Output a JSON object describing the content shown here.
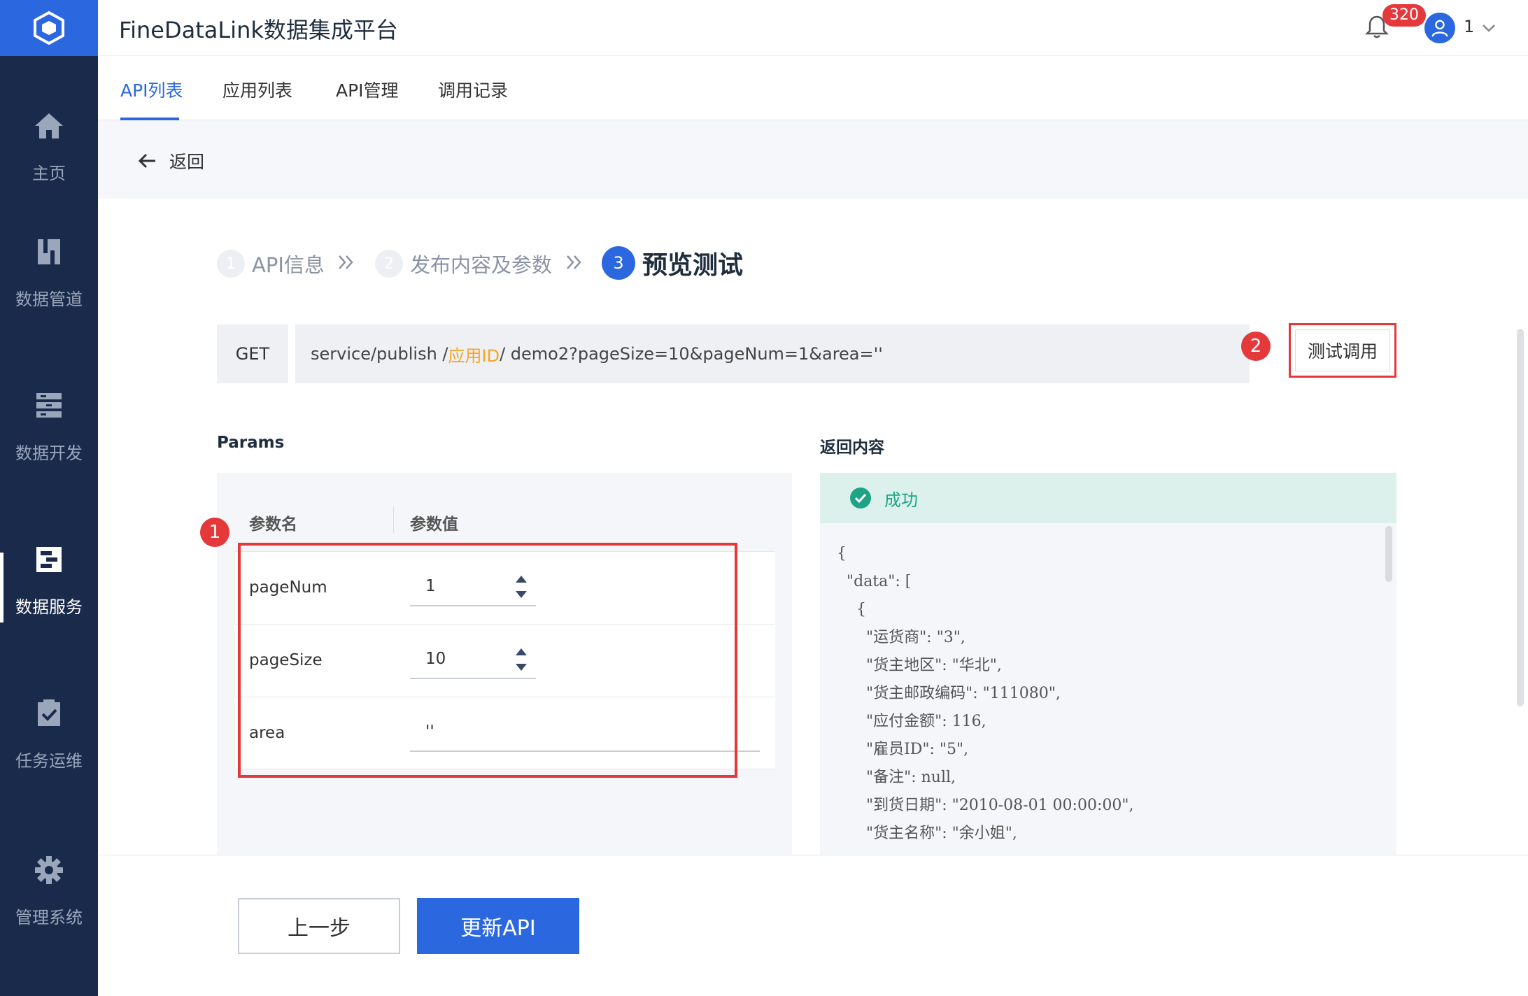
{
  "app": {
    "title": "FineDataLink数据集成平台"
  },
  "header": {
    "notification_count": "320",
    "user_name": "1"
  },
  "sidebar": {
    "items": [
      {
        "label": "主页",
        "icon": "home-icon"
      },
      {
        "label": "数据管道",
        "icon": "pipeline-icon"
      },
      {
        "label": "数据开发",
        "icon": "dev-icon"
      },
      {
        "label": "数据服务",
        "icon": "service-icon"
      },
      {
        "label": "任务运维",
        "icon": "task-icon"
      },
      {
        "label": "管理系统",
        "icon": "gear-icon"
      }
    ]
  },
  "tabs": [
    {
      "label": "API列表"
    },
    {
      "label": "应用列表"
    },
    {
      "label": "API管理"
    },
    {
      "label": "调用记录"
    }
  ],
  "back_label": "返回",
  "steps": [
    {
      "num": "1",
      "label": "API信息"
    },
    {
      "num": "2",
      "label": "发布内容及参数"
    },
    {
      "num": "3",
      "label": "预览测试"
    }
  ],
  "request": {
    "method": "GET",
    "url_prefix": "service/publish /",
    "url_highlight": "应用ID",
    "url_suffix": "/ demo2?pageSize=10&pageNum=1&area=''"
  },
  "test_button": "测试调用",
  "markers": {
    "m1": "1",
    "m2": "2"
  },
  "params": {
    "title": "Params",
    "col_name": "参数名",
    "col_value": "参数值",
    "rows": [
      {
        "name": "pageNum",
        "value": "1"
      },
      {
        "name": "pageSize",
        "value": "10"
      },
      {
        "name": "area",
        "value": "''"
      }
    ]
  },
  "response": {
    "title": "返回内容",
    "status": "成功",
    "lines": [
      "{",
      "  \"data\": [",
      "    {",
      "      \"运货商\": \"3\",",
      "      \"货主地区\": \"华北\",",
      "      \"货主邮政编码\": \"111080\",",
      "      \"应付金额\": 116,",
      "      \"雇员ID\": \"5\",",
      "      \"备注\": null,",
      "      \"到货日期\": \"2010-08-01 00:00:00\",",
      "      \"货主名称\": \"余小姐\","
    ]
  },
  "footer": {
    "prev": "上一步",
    "update": "更新API"
  }
}
